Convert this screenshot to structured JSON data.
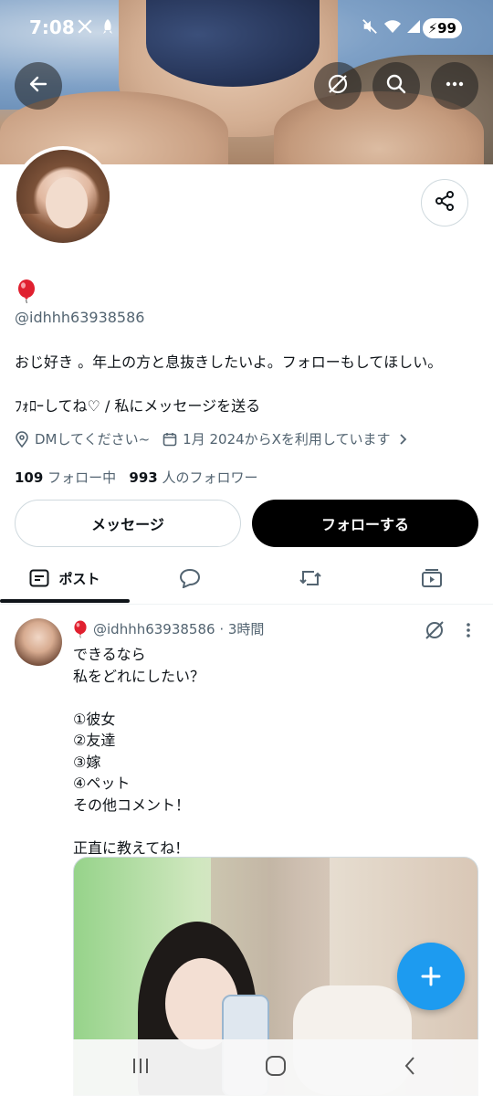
{
  "status_bar": {
    "time": "7:08",
    "battery": "99",
    "icons": [
      "x-logo-icon",
      "rocket-icon",
      "mute-icon",
      "wifi-icon",
      "signal-icon",
      "battery-icon"
    ]
  },
  "header": {
    "back_icon": "arrow-left-icon",
    "grok_icon": "grok-icon",
    "search_icon": "search-icon",
    "more_icon": "more-horizontal-icon"
  },
  "profile": {
    "name_emoji": "🎈",
    "handle": "@idhhh63938586",
    "bio": "おじ好き 。年上の方と息抜きしたいよ。フォローもしてほしい。",
    "bio2": "ﾌｫﾛｰしてね♡ / 私にメッセージを送る",
    "location": "DMしてください~",
    "joined": "1月 2024からXを利用しています",
    "following_count": "109",
    "following_label": "フォロー中",
    "followers_count": "993",
    "followers_label": "人のフォロワー",
    "share_icon": "share-icon"
  },
  "actions": {
    "message_label": "メッセージ",
    "follow_label": "フォローする"
  },
  "tabs": [
    {
      "label": "ポスト",
      "icon": "post-icon",
      "active": true
    },
    {
      "label": "",
      "icon": "reply-icon",
      "active": false
    },
    {
      "label": "",
      "icon": "repost-icon",
      "active": false
    },
    {
      "label": "",
      "icon": "media-icon",
      "active": false
    }
  ],
  "post": {
    "emoji": "🎈",
    "handle": "@idhhh63938586",
    "time": "· 3時間",
    "text": "できるなら\n私をどれにしたい？\n\n①彼女\n②友達\n③嫁\n④ペット\nその他コメント！\n\n正直に教えてね！"
  },
  "colors": {
    "accent": "#1d9bf0",
    "text": "#0f1419",
    "muted": "#536471",
    "border": "#cfd9de"
  }
}
